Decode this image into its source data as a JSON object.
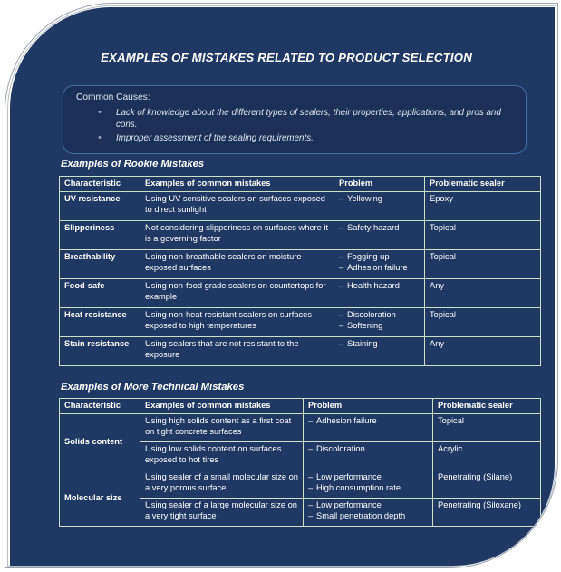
{
  "slide": {
    "title": "EXAMPLES OF MISTAKES RELATED TO PRODUCT SELECTION",
    "background_color": "#1f3864",
    "border_color": "#cfe0c8",
    "text_color": "#ffffff"
  },
  "causes": {
    "heading": "Common Causes:",
    "items": [
      "Lack of knowledge about the different types of sealers, their properties, applications, and pros and cons.",
      "Improper assessment of the sealing requirements."
    ]
  },
  "sections": [
    {
      "heading": "Examples of Rookie Mistakes",
      "columns": [
        "Characteristic",
        "Examples of common mistakes",
        "Problem",
        "Problematic sealer"
      ],
      "rows": [
        {
          "characteristic": "UV resistance",
          "mistake": "Using UV sensitive sealers on surfaces exposed to direct sunlight",
          "problems": [
            "Yellowing"
          ],
          "sealer": "Epoxy"
        },
        {
          "characteristic": "Slipperiness",
          "mistake": "Not considering slipperiness on surfaces where it is a governing factor",
          "problems": [
            "Safety hazard"
          ],
          "sealer": "Topical"
        },
        {
          "characteristic": "Breathability",
          "mistake": "Using non-breathable sealers on moisture-exposed surfaces",
          "problems": [
            "Fogging up",
            "Adhesion failure"
          ],
          "sealer": "Topical"
        },
        {
          "characteristic": "Food-safe",
          "mistake": "Using non-food grade sealers on countertops for example",
          "problems": [
            "Health hazard"
          ],
          "sealer": "Any"
        },
        {
          "characteristic": "Heat resistance",
          "mistake": "Using non-heat resistant sealers on surfaces exposed to high temperatures",
          "problems": [
            "Discoloration",
            "Softening"
          ],
          "sealer": "Topical"
        },
        {
          "characteristic": "Stain resistance",
          "mistake": "Using sealers that are not resistant to the exposure",
          "problems": [
            "Staining"
          ],
          "sealer": "Any"
        }
      ]
    },
    {
      "heading": "Examples of More Technical Mistakes",
      "columns": [
        "Characteristic",
        "Examples of common mistakes",
        "Problem",
        "Problematic sealer"
      ],
      "groups": [
        {
          "characteristic": "Solids content",
          "rows": [
            {
              "mistake": "Using high solids content as a first coat on tight concrete surfaces",
              "problems": [
                "Adhesion failure"
              ],
              "sealer": "Topical"
            },
            {
              "mistake": "Using low solids content on surfaces exposed to hot tires",
              "problems": [
                "Discoloration"
              ],
              "sealer": "Acrylic"
            }
          ]
        },
        {
          "characteristic": "Molecular size",
          "rows": [
            {
              "mistake": "Using sealer of a small molecular size on a very porous surface",
              "problems": [
                "Low performance",
                "High consumption rate"
              ],
              "sealer": "Penetrating (Silane)"
            },
            {
              "mistake": "Using sealer of a large molecular size on a very tight surface",
              "problems": [
                "Low performance",
                "Small penetration depth"
              ],
              "sealer": "Penetrating (Siloxane)"
            }
          ]
        }
      ]
    }
  ]
}
